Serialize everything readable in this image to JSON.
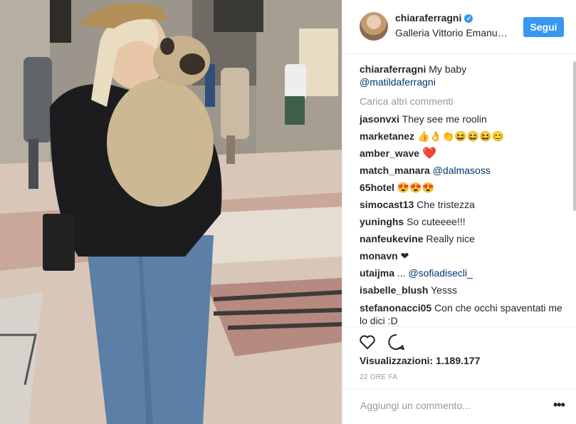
{
  "post": {
    "username": "chiaraferragni",
    "location": "Galleria Vittorio Emanuele II",
    "follow_label": "Segui",
    "caption_user": "chiaraferragni",
    "caption_text": "My baby",
    "caption_mention": "@matildaferragni",
    "load_more": "Carica altri commenti",
    "comments": [
      {
        "user": "jasonvxi",
        "text": "They see me roolin"
      },
      {
        "user": "marketanez",
        "text": "👍👌👏😆😆😆😊"
      },
      {
        "user": "amber_wave",
        "text": "❤️"
      },
      {
        "user": "match_manara",
        "text": "@dalmasoss"
      },
      {
        "user": "65hotel",
        "text": "😍😍😍"
      },
      {
        "user": "simocast13",
        "text": "Che tristezza"
      },
      {
        "user": "yuninghs",
        "text": "So cuteeee!!!"
      },
      {
        "user": "nanfeukevine",
        "text": "Really nice"
      },
      {
        "user": "monavn",
        "text": "❤"
      },
      {
        "user": "utaijma",
        "text": "... @sofiadisecli_"
      },
      {
        "user": "isabelle_blush",
        "text": "Yesss"
      },
      {
        "user": "stefanonacci05",
        "text": "Con che occhi spaventati me lo dici :D"
      }
    ],
    "views": "Visualizzazioni: 1.189.177",
    "time": "22 ORE FA",
    "comment_placeholder": "Aggiungi un commento...",
    "more_label": "•••"
  },
  "colors": {
    "accent": "#3897f0",
    "mention": "#003569",
    "muted": "#999999",
    "text": "#262626"
  },
  "icons": [
    "verified-badge-icon",
    "heart-icon",
    "comment-icon",
    "more-options-icon"
  ]
}
